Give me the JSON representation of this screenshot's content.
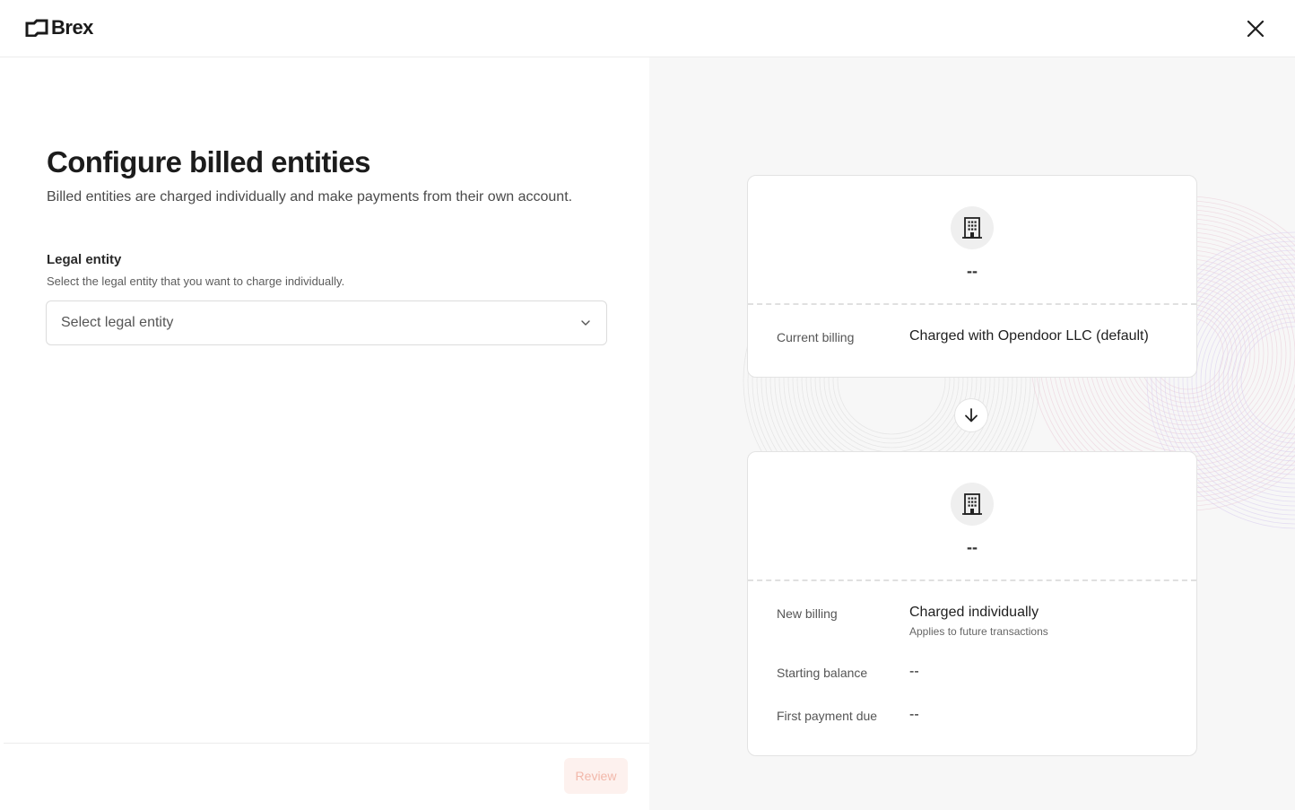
{
  "header": {
    "logo_text": "Brex",
    "close_icon": "close-icon"
  },
  "form": {
    "title": "Configure billed entities",
    "subtitle": "Billed entities are charged individually and make payments from their own account.",
    "legal_entity": {
      "label": "Legal entity",
      "help": "Select the legal entity that you want to charge individually.",
      "placeholder": "Select legal entity",
      "value": ""
    }
  },
  "footer": {
    "review_label": "Review",
    "review_disabled": true
  },
  "preview": {
    "current": {
      "entity_name": "--",
      "icon": "building-icon",
      "billing_label": "Current billing",
      "billing_value": "Charged with Opendoor LLC (default)"
    },
    "arrow_icon": "arrow-down-icon",
    "new": {
      "entity_name": "--",
      "icon": "building-icon",
      "billing_label": "New billing",
      "billing_value": "Charged individually",
      "billing_note": "Applies to future transactions",
      "starting_balance_label": "Starting balance",
      "starting_balance_value": "--",
      "first_payment_label": "First payment due",
      "first_payment_value": "--"
    }
  },
  "colors": {
    "accent_disabled_bg": "#fdf1ee",
    "accent_disabled_text": "#f2b8aa",
    "panel_bg": "#f7f7f7"
  }
}
